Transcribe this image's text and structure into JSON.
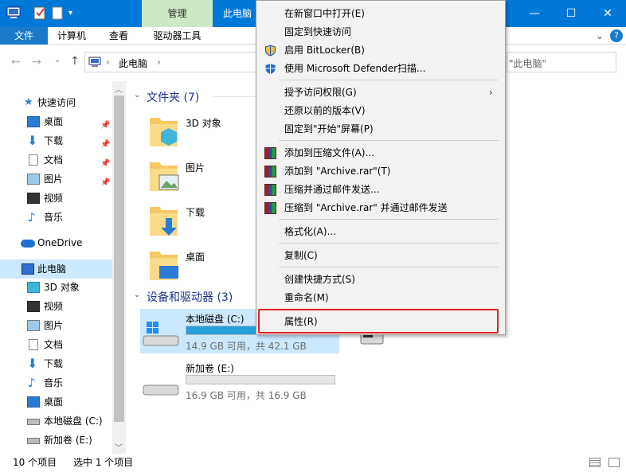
{
  "window": {
    "title": "此电脑",
    "manage_tab": "管理",
    "colors": {
      "accent": "#0078d7",
      "manage": "#cde8c5"
    }
  },
  "ribbon": {
    "tabs": [
      "文件",
      "计算机",
      "查看",
      "驱动器工具"
    ]
  },
  "address": {
    "path": "此电脑",
    "search_placeholder": "\"此电脑\""
  },
  "sidebar": {
    "quick_access": "快速访问",
    "items": [
      {
        "label": "桌面",
        "icon": "desktop-icon",
        "pinned": true
      },
      {
        "label": "下载",
        "icon": "download-icon",
        "pinned": true
      },
      {
        "label": "文档",
        "icon": "document-icon",
        "pinned": true
      },
      {
        "label": "图片",
        "icon": "picture-icon",
        "pinned": true
      },
      {
        "label": "视频",
        "icon": "video-icon"
      },
      {
        "label": "音乐",
        "icon": "music-icon"
      }
    ],
    "onedrive": "OneDrive",
    "this_pc": "此电脑",
    "pc_items": [
      {
        "label": "3D 对象",
        "icon": "3d-objects-icon"
      },
      {
        "label": "视频",
        "icon": "video-icon"
      },
      {
        "label": "图片",
        "icon": "picture-icon"
      },
      {
        "label": "文档",
        "icon": "document-icon"
      },
      {
        "label": "下载",
        "icon": "download-icon"
      },
      {
        "label": "音乐",
        "icon": "music-icon"
      },
      {
        "label": "桌面",
        "icon": "desktop-icon"
      },
      {
        "label": "本地磁盘 (C:)",
        "icon": "drive-icon"
      },
      {
        "label": "新加卷 (E:)",
        "icon": "drive-icon"
      }
    ]
  },
  "content": {
    "folders_header": "文件夹 (7)",
    "folders": [
      "3D 对象",
      "图片",
      "下载",
      "桌面"
    ],
    "devices_header": "设备和驱动器 (3)",
    "drives": [
      {
        "name": "本地磁盘 (C:)",
        "space": "14.9 GB 可用，共 42.1 GB",
        "used_fraction": 0.65
      },
      {
        "name": "新加卷 (E:)",
        "space": "16.9 GB 可用，共 16.9 GB",
        "used_fraction": 0.0
      }
    ]
  },
  "status": {
    "count": "10 个项目",
    "selected": "选中 1 个项目"
  },
  "context_menu": {
    "items": [
      {
        "label": "在新窗口中打开(E)"
      },
      {
        "label": "固定到快速访问"
      },
      {
        "label": "启用 BitLocker(B)",
        "icon": "shield-icon"
      },
      {
        "label": "使用 Microsoft Defender扫描...",
        "icon": "defender-icon"
      },
      {
        "label": "授予访问权限(G)",
        "submenu": true
      },
      {
        "label": "还原以前的版本(V)"
      },
      {
        "label": "固定到\"开始\"屏幕(P)"
      },
      {
        "label": "添加到压缩文件(A)...",
        "icon": "winrar-icon"
      },
      {
        "label": "添加到 \"Archive.rar\"(T)",
        "icon": "winrar-icon"
      },
      {
        "label": "压缩并通过邮件发送...",
        "icon": "winrar-icon"
      },
      {
        "label": "压缩到 \"Archive.rar\" 并通过邮件发送",
        "icon": "winrar-icon"
      },
      {
        "label": "格式化(A)..."
      },
      {
        "label": "复制(C)"
      },
      {
        "label": "创建快捷方式(S)"
      },
      {
        "label": "重命名(M)"
      },
      {
        "label": "属性(R)"
      }
    ]
  }
}
